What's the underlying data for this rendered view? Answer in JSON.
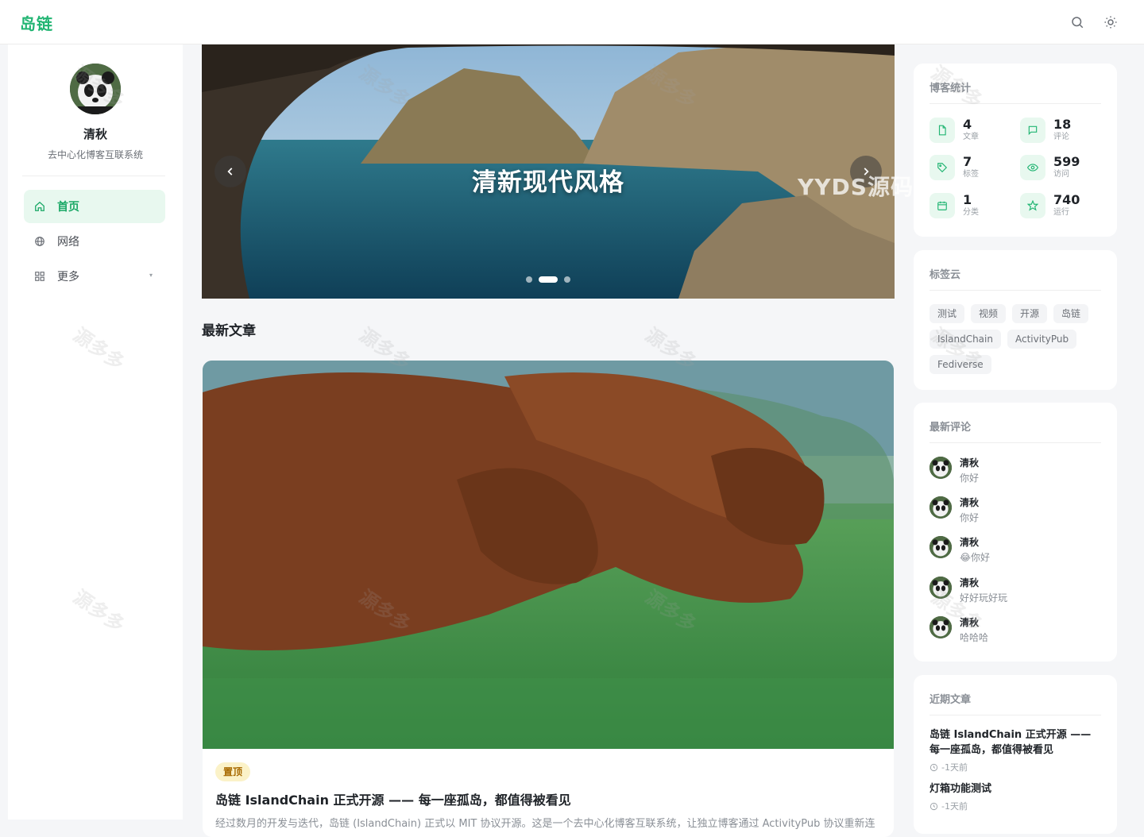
{
  "header": {
    "logo": "岛链",
    "search_icon": "search-icon",
    "theme_icon": "sun-icon"
  },
  "sidebar": {
    "profile": {
      "name": "清秋",
      "subtitle": "去中心化博客互联系统"
    },
    "nav": [
      {
        "label": "首页",
        "icon": "home-icon",
        "active": true
      },
      {
        "label": "网络",
        "icon": "globe-icon",
        "active": false
      },
      {
        "label": "更多",
        "icon": "grid-icon",
        "active": false
      }
    ]
  },
  "carousel": {
    "title": "清新现代风格",
    "active_index": 1,
    "count": 3
  },
  "main": {
    "section_title": "最新文章",
    "post": {
      "badge": "置顶",
      "title": "岛链 IslandChain 正式开源 —— 每一座孤岛，都值得被看见",
      "excerpt": "经过数月的开发与迭代，岛链 (IslandChain) 正式以 MIT 协议开源。这是一个去中心化博客互联系统，让独立博客通过 ActivityPub 协议重新连"
    }
  },
  "stats": {
    "title": "博客统计",
    "items": [
      {
        "value": "4",
        "label": "文章",
        "icon": "file-icon"
      },
      {
        "value": "18",
        "label": "评论",
        "icon": "message-icon"
      },
      {
        "value": "7",
        "label": "标签",
        "icon": "tag-icon"
      },
      {
        "value": "599",
        "label": "访问",
        "icon": "eye-icon"
      },
      {
        "value": "1",
        "label": "分类",
        "icon": "calendar-icon"
      },
      {
        "value": "740",
        "label": "运行",
        "icon": "star-icon"
      }
    ]
  },
  "tag_cloud": {
    "title": "标签云",
    "tags": [
      "测试",
      "视频",
      "开源",
      "岛链",
      "IslandChain",
      "ActivityPub",
      "Fediverse"
    ]
  },
  "comments": {
    "title": "最新评论",
    "items": [
      {
        "name": "清秋",
        "text": "你好"
      },
      {
        "name": "清秋",
        "text": "你好"
      },
      {
        "name": "清秋",
        "text": "😂你好"
      },
      {
        "name": "清秋",
        "text": "好好玩好玩"
      },
      {
        "name": "清秋",
        "text": "哈哈哈"
      }
    ]
  },
  "recent_posts": {
    "title": "近期文章",
    "items": [
      {
        "title": "岛链 IslandChain 正式开源 —— 每一座孤岛，都值得被看见",
        "time": "-1天前"
      },
      {
        "title": "灯箱功能测试",
        "time": "-1天前"
      }
    ]
  },
  "overlays": {
    "watermark": "源多多",
    "watermark_url": "Zyydd.Com",
    "carousel_watermark": "YYDS源码网"
  },
  "colors": {
    "accent": "#22b573",
    "active_bg": "#e8f8ef",
    "pin_bg": "#fbf2c8",
    "pin_text": "#a86a00"
  }
}
